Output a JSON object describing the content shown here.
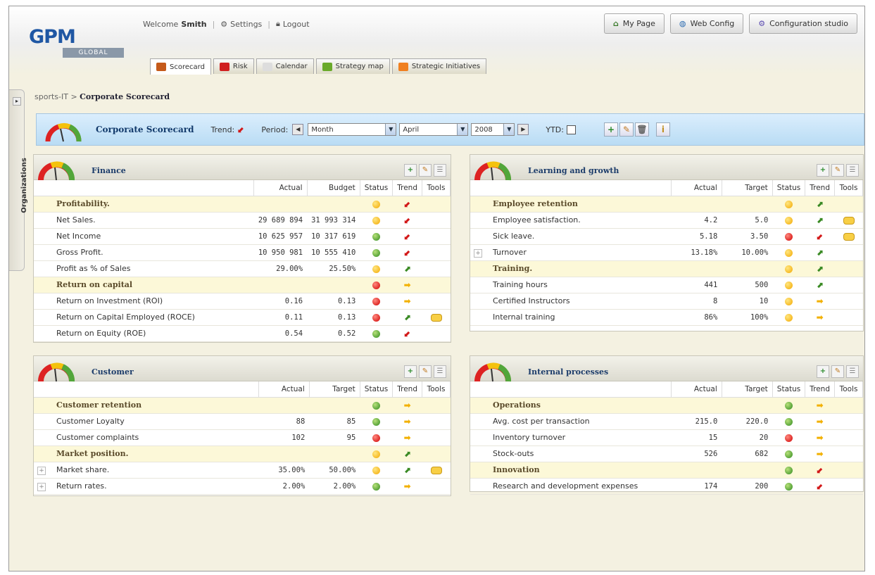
{
  "app": {
    "logo_main": "GPM",
    "logo_sub": "GLOBAL"
  },
  "user": {
    "welcome": "Welcome",
    "name": "Smith",
    "settings": "Settings",
    "logout": "Logout"
  },
  "top_buttons": {
    "my_page": "My Page",
    "web_config": "Web Config",
    "config_studio": "Configuration studio"
  },
  "tabs": [
    {
      "label": "Scorecard",
      "icon": "scorecard-icon",
      "color": "#c55a1a"
    },
    {
      "label": "Risk",
      "icon": "risk-icon",
      "color": "#d02020"
    },
    {
      "label": "Calendar",
      "icon": "calendar-icon",
      "color": "#dddddd"
    },
    {
      "label": "Strategy map",
      "icon": "strategy-map-icon",
      "color": "#6aaa2a"
    },
    {
      "label": "Strategic Initiatives",
      "icon": "initiatives-icon",
      "color": "#f08020"
    }
  ],
  "sidebar": {
    "label": "Organizations"
  },
  "breadcrumb": {
    "parent": "sports-IT",
    "sep": ">",
    "current": "Corporate Scorecard"
  },
  "scorecard_bar": {
    "title": "Corporate Scorecard",
    "trend_label": "Trend:",
    "period_label": "Period:",
    "period_type": "Month",
    "month": "April",
    "year": "2008",
    "ytd_label": "YTD:"
  },
  "colors": {
    "yellow": "#f3a800",
    "red": "#d00000",
    "green": "#2f8a1e",
    "accent": "#1c3c6a"
  },
  "finance": {
    "title": "Finance",
    "headers": [
      "Actual",
      "Budget",
      "Status",
      "Trend",
      "Tools"
    ],
    "rows": [
      {
        "type": "group",
        "name": "Profitability.",
        "status": "yellow",
        "trend": "down"
      },
      {
        "name": "Net Sales.",
        "actual": "29 689 894",
        "target": "31 993 314",
        "status": "yellow",
        "trend": "down"
      },
      {
        "name": "Net Income",
        "actual": "10 625 957",
        "target": "10 317 619",
        "status": "green",
        "trend": "down"
      },
      {
        "name": "Gross Profit.",
        "actual": "10 950 981",
        "target": "10 555 410",
        "status": "green",
        "trend": "down"
      },
      {
        "name": "Profit as % of Sales",
        "actual": "29.00%",
        "target": "25.50%",
        "status": "yellow",
        "trend": "up"
      },
      {
        "type": "group",
        "name": "Return on capital",
        "status": "red",
        "trend": "side"
      },
      {
        "name": "Return on Investment (ROI)",
        "actual": "0.16",
        "target": "0.13",
        "status": "red",
        "trend": "side"
      },
      {
        "name": "Return on Capital Employed (ROCE)",
        "actual": "0.11",
        "target": "0.13",
        "status": "red",
        "trend": "up",
        "tool": true
      },
      {
        "name": "Return on Equity (ROE)",
        "actual": "0.54",
        "target": "0.52",
        "status": "green",
        "trend": "down"
      }
    ]
  },
  "learning": {
    "title": "Learning and growth",
    "headers": [
      "Actual",
      "Target",
      "Status",
      "Trend",
      "Tools"
    ],
    "rows": [
      {
        "type": "group",
        "name": "Employee retention",
        "status": "yellow",
        "trend": "up"
      },
      {
        "name": "Employee satisfaction.",
        "actual": "4.2",
        "target": "5.0",
        "status": "yellow",
        "trend": "up",
        "tool": true
      },
      {
        "name": "Sick leave.",
        "actual": "5.18",
        "target": "3.50",
        "status": "red",
        "trend": "down",
        "tool": true
      },
      {
        "name": "Turnover",
        "actual": "13.18%",
        "target": "10.00%",
        "status": "yellow",
        "trend": "up",
        "expand": true
      },
      {
        "type": "group",
        "name": "Training.",
        "status": "yellow",
        "trend": "up"
      },
      {
        "name": "Training hours",
        "actual": "441",
        "target": "500",
        "status": "yellow",
        "trend": "up"
      },
      {
        "name": "Certified Instructors",
        "actual": "8",
        "target": "10",
        "status": "yellow",
        "trend": "side"
      },
      {
        "name": "Internal training",
        "actual": "86%",
        "target": "100%",
        "status": "yellow",
        "trend": "side"
      }
    ]
  },
  "customer": {
    "title": "Customer",
    "headers": [
      "Actual",
      "Target",
      "Status",
      "Trend",
      "Tools"
    ],
    "rows": [
      {
        "type": "group",
        "name": "Customer retention",
        "status": "green",
        "trend": "side"
      },
      {
        "name": "Customer Loyalty",
        "actual": "88",
        "target": "85",
        "status": "green",
        "trend": "side"
      },
      {
        "name": "Customer complaints",
        "actual": "102",
        "target": "95",
        "status": "red",
        "trend": "side"
      },
      {
        "type": "group",
        "name": "Market position.",
        "status": "yellow",
        "trend": "up"
      },
      {
        "name": "Market share.",
        "actual": "35.00%",
        "target": "50.00%",
        "status": "yellow",
        "trend": "up",
        "tool": true,
        "expand": true
      },
      {
        "name": "Return rates.",
        "actual": "2.00%",
        "target": "2.00%",
        "status": "green",
        "trend": "side",
        "expand": true
      }
    ]
  },
  "internal": {
    "title": "Internal processes",
    "headers": [
      "Actual",
      "Target",
      "Status",
      "Trend",
      "Tools"
    ],
    "rows": [
      {
        "type": "group",
        "name": "Operations",
        "status": "green",
        "trend": "side"
      },
      {
        "name": "Avg. cost per transaction",
        "actual": "215.0",
        "target": "220.0",
        "status": "green",
        "trend": "side"
      },
      {
        "name": "Inventory turnover",
        "actual": "15",
        "target": "20",
        "status": "red",
        "trend": "side"
      },
      {
        "name": "Stock-outs",
        "actual": "526",
        "target": "682",
        "status": "green",
        "trend": "side"
      },
      {
        "type": "group",
        "name": "Innovation",
        "status": "green",
        "trend": "down"
      },
      {
        "name": "Research and development expenses",
        "actual": "174",
        "target": "200",
        "status": "green",
        "trend": "down"
      }
    ]
  }
}
